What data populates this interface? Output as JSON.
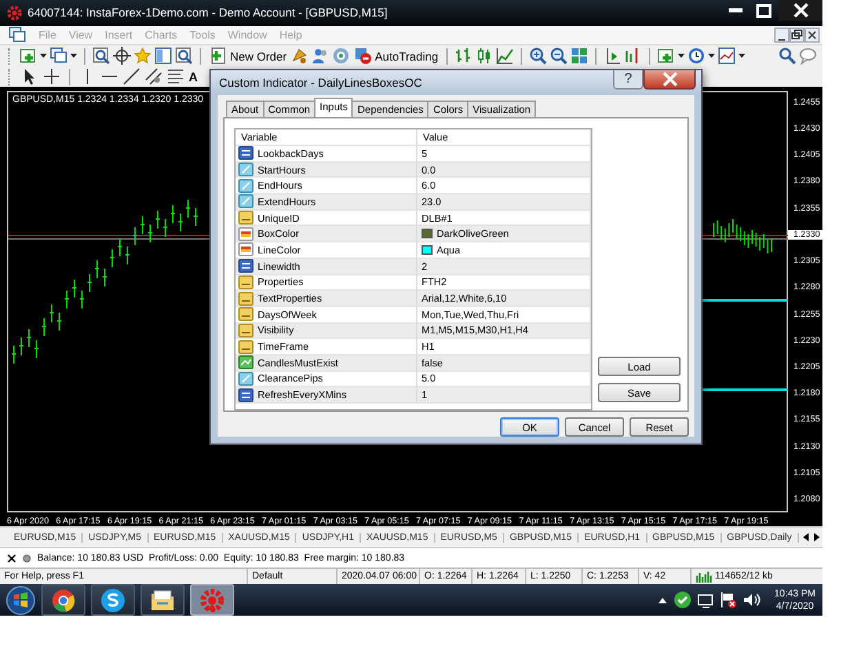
{
  "window": {
    "title": "64007144: InstaForex-1Demo.com - Demo Account - [GBPUSD,M15]"
  },
  "menu": [
    {
      "label": "File",
      "disabled": true
    },
    {
      "label": "View",
      "disabled": true
    },
    {
      "label": "Insert",
      "disabled": true
    },
    {
      "label": "Charts",
      "disabled": true
    },
    {
      "label": "Tools",
      "disabled": true
    },
    {
      "label": "Window",
      "disabled": true
    },
    {
      "label": "Help",
      "disabled": true
    }
  ],
  "toolbar": {
    "new_order": "New Order",
    "auto_trading": "AutoTrading",
    "text_tool": "A"
  },
  "chart": {
    "header": "GBPUSD,M15 1.2324 1.2334 1.2320 1.2330",
    "price_labels": [
      {
        "text": "1.2455",
        "highlighted": false
      },
      {
        "text": "1.2430",
        "highlighted": false
      },
      {
        "text": "1.2405",
        "highlighted": false
      },
      {
        "text": "1.2380",
        "highlighted": false
      },
      {
        "text": "1.2355",
        "highlighted": false
      },
      {
        "text": "1.2330",
        "highlighted": true
      },
      {
        "text": "1.2305",
        "highlighted": false
      },
      {
        "text": "1.2280",
        "highlighted": false
      },
      {
        "text": "1.2255",
        "highlighted": false
      },
      {
        "text": "1.2230",
        "highlighted": false
      },
      {
        "text": "1.2205",
        "highlighted": false
      },
      {
        "text": "1.2180",
        "highlighted": false
      },
      {
        "text": "1.2155",
        "highlighted": false
      },
      {
        "text": "1.2130",
        "highlighted": false
      },
      {
        "text": "1.2105",
        "highlighted": false
      },
      {
        "text": "1.2080",
        "highlighted": false
      }
    ],
    "time_labels": [
      "6 Apr 2020",
      "6 Apr 17:15",
      "6 Apr 19:15",
      "6 Apr 21:15",
      "6 Apr 23:15",
      "7 Apr 01:15",
      "7 Apr 03:15",
      "7 Apr 05:15",
      "7 Apr 07:15",
      "7 Apr 09:15",
      "7 Apr 11:15",
      "7 Apr 13:15",
      "7 Apr 15:15",
      "7 Apr 17:15",
      "7 Apr 19:15"
    ]
  },
  "dialog": {
    "title": "Custom Indicator - DailyLinesBoxesOC",
    "help": "?",
    "tabs": [
      {
        "label": "About",
        "selected": false
      },
      {
        "label": "Common",
        "selected": false
      },
      {
        "label": "Inputs",
        "selected": true
      },
      {
        "label": "Dependencies",
        "selected": false
      },
      {
        "label": "Colors",
        "selected": false
      },
      {
        "label": "Visualization",
        "selected": false
      }
    ],
    "columns": [
      "Variable",
      "Value"
    ],
    "rows": [
      {
        "kind": "int",
        "name": "LookbackDays",
        "value": "5"
      },
      {
        "kind": "double",
        "name": "StartHours",
        "value": "0.0"
      },
      {
        "kind": "double",
        "name": "EndHours",
        "value": "6.0"
      },
      {
        "kind": "double",
        "name": "ExtendHours",
        "value": "23.0"
      },
      {
        "kind": "string",
        "name": "UniqueID",
        "value": "DLB#1"
      },
      {
        "kind": "color",
        "name": "BoxColor",
        "value": "DarkOliveGreen",
        "color": "#556b2f"
      },
      {
        "kind": "color",
        "name": "LineColor",
        "value": "Aqua",
        "color": "#00ffff"
      },
      {
        "kind": "int",
        "name": "Linewidth",
        "value": "2"
      },
      {
        "kind": "string",
        "name": "Properties",
        "value": "FTH2"
      },
      {
        "kind": "string",
        "name": "TextProperties",
        "value": "Arial,12,White,6,10"
      },
      {
        "kind": "string",
        "name": "DaysOfWeek",
        "value": "Mon,Tue,Wed,Thu,Fri"
      },
      {
        "kind": "string",
        "name": "Visibility",
        "value": "M1,M5,M15,M30,H1,H4"
      },
      {
        "kind": "string",
        "name": "TimeFrame",
        "value": "H1"
      },
      {
        "kind": "bool",
        "name": "CandlesMustExist",
        "value": "false"
      },
      {
        "kind": "double",
        "name": "ClearancePips",
        "value": "5.0"
      },
      {
        "kind": "int",
        "name": "RefreshEveryXMins",
        "value": "1"
      }
    ],
    "side_buttons": [
      "Load",
      "Save"
    ],
    "buttons": [
      {
        "label": "OK",
        "default": true
      },
      {
        "label": "Cancel",
        "default": false
      },
      {
        "label": "Reset",
        "default": false
      }
    ]
  },
  "symbol_tabs": [
    "EURUSD,M15",
    "USDJPY,M5",
    "EURUSD,M15",
    "XAUUSD,M15",
    "USDJPY,H1",
    "XAUUSD,M15",
    "EURUSD,M5",
    "GBPUSD,M15",
    "EURUSD,H1",
    "GBPUSD,M15",
    "GBPUSD,Daily"
  ],
  "account": "Balance: 10 180.83 USD  Profit/Loss: 0.00  Equity: 10 180.83  Free margin: 10 180.83",
  "status_bar": [
    "For Help, press F1",
    "Default",
    "2020.04.07 06:00",
    "O: 1.2264",
    "H: 1.2264",
    "L: 1.2250",
    "C: 1.2253",
    "V: 42",
    "114652/12 kb"
  ],
  "taskbar": {
    "time": "10:43 PM",
    "date": "4/7/2020"
  }
}
